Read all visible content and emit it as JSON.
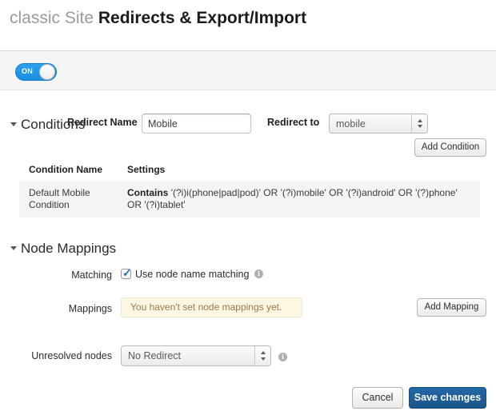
{
  "title": {
    "site": "classic Site",
    "document": "Redirects & Export/Import"
  },
  "top_panel": {
    "toggle": {
      "state_label": "ON",
      "enabled": true,
      "color": "#1a8fe0"
    },
    "redirect_name": {
      "label": "Redirect Name",
      "value": "Mobile",
      "placeholder": ""
    },
    "redirect_to": {
      "label": "Redirect to",
      "selected": "mobile"
    }
  },
  "conditions": {
    "heading": "Conditions",
    "add_button": "Add Condition",
    "columns": [
      "Condition Name",
      "Settings"
    ],
    "rows": [
      {
        "name": "Default Mobile Condition",
        "operator": "Contains",
        "settings": "'(?i)i(phone|pad|pod)' OR '(?i)mobile' OR '(?i)android' OR '(?)phone' OR '(?i)tablet'"
      }
    ]
  },
  "node_mappings": {
    "heading": "Node Mappings",
    "matching": {
      "label": "Matching",
      "checkbox_label": "Use node name matching",
      "checked": true,
      "info": "info-icon"
    },
    "mappings": {
      "label": "Mappings",
      "empty_notice": "You haven't set node mappings yet.",
      "add_button": "Add Mapping"
    },
    "unresolved": {
      "label": "Unresolved nodes",
      "selected": "No Redirect",
      "info": "info-icon"
    }
  },
  "footer": {
    "cancel": "Cancel",
    "save": "Save changes",
    "save_color": "#1b5589"
  }
}
